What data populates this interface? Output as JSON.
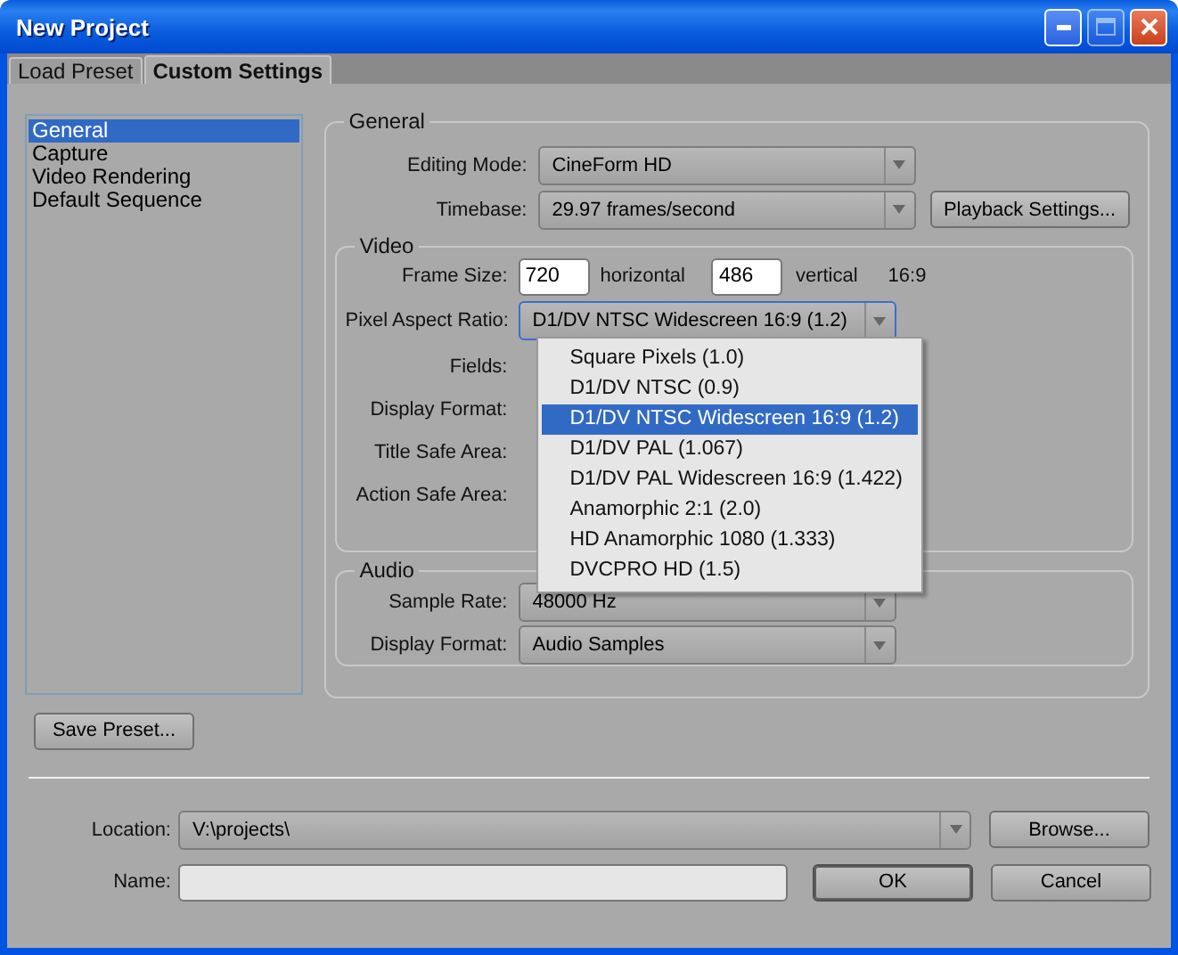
{
  "window": {
    "title": "New Project"
  },
  "tabs": [
    {
      "label": "Load Preset",
      "selected": false
    },
    {
      "label": "Custom Settings",
      "selected": true
    }
  ],
  "sidebar": {
    "items": [
      {
        "label": "General",
        "selected": true
      },
      {
        "label": "Capture",
        "selected": false
      },
      {
        "label": "Video Rendering",
        "selected": false
      },
      {
        "label": "Default Sequence",
        "selected": false
      }
    ]
  },
  "general": {
    "title": "General",
    "editing_mode": {
      "label": "Editing Mode:",
      "value": "CineForm HD"
    },
    "timebase": {
      "label": "Timebase:",
      "value": "29.97 frames/second"
    },
    "playback_button": "Playback Settings..."
  },
  "video": {
    "title": "Video",
    "frame_size": {
      "label": "Frame Size:",
      "horizontal": "720",
      "horizontal_label": "horizontal",
      "vertical": "486",
      "vertical_label": "vertical",
      "aspect": "16:9"
    },
    "pixel_aspect_ratio": {
      "label": "Pixel Aspect Ratio:",
      "value": "D1/DV NTSC Widescreen 16:9 (1.2)",
      "expanded": true,
      "options": [
        {
          "label": "Square Pixels (1.0)",
          "selected": false
        },
        {
          "label": "D1/DV NTSC (0.9)",
          "selected": false
        },
        {
          "label": "D1/DV NTSC Widescreen 16:9 (1.2)",
          "selected": true
        },
        {
          "label": "D1/DV PAL (1.067)",
          "selected": false
        },
        {
          "label": "D1/DV PAL Widescreen 16:9 (1.422)",
          "selected": false
        },
        {
          "label": "Anamorphic 2:1 (2.0)",
          "selected": false
        },
        {
          "label": "HD Anamorphic 1080 (1.333)",
          "selected": false
        },
        {
          "label": "DVCPRO HD (1.5)",
          "selected": false
        }
      ]
    },
    "hidden_rows": [
      "Fields:",
      "Display Format:",
      "Title Safe Area:",
      "Action Safe Area:"
    ]
  },
  "audio": {
    "title": "Audio",
    "rows": [
      {
        "label": "Sample Rate:",
        "value": "48000 Hz"
      },
      {
        "label": "Display Format:",
        "value": "Audio Samples"
      }
    ]
  },
  "save_preset_button": "Save Preset...",
  "location": {
    "label": "Location:",
    "value": "V:\\projects\\",
    "browse_button": "Browse..."
  },
  "name": {
    "label": "Name:"
  },
  "buttons": [
    {
      "label": "OK",
      "default": true
    },
    {
      "label": "Cancel",
      "default": false
    }
  ]
}
